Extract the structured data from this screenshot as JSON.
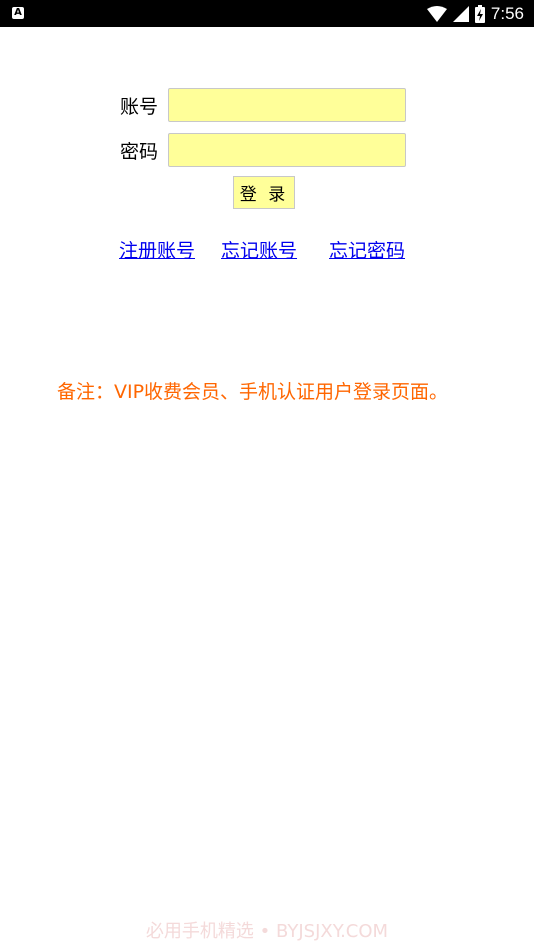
{
  "status_bar": {
    "app_icon_letter": "A",
    "time": "7:56"
  },
  "login_form": {
    "account_label": "账号",
    "account_value": "",
    "password_label": "密码",
    "password_value": "",
    "login_button": "登 录"
  },
  "links": {
    "register": "注册账号",
    "forgot_account": "忘记账号",
    "forgot_password": "忘记密码"
  },
  "note": "备注：VIP收费会员、手机认证用户登录页面。",
  "watermark": "必用手机精选 • BYJSJXY.COM",
  "colors": {
    "input_bg": "#ffff99",
    "link": "#0000ee",
    "note": "#ff6600"
  }
}
